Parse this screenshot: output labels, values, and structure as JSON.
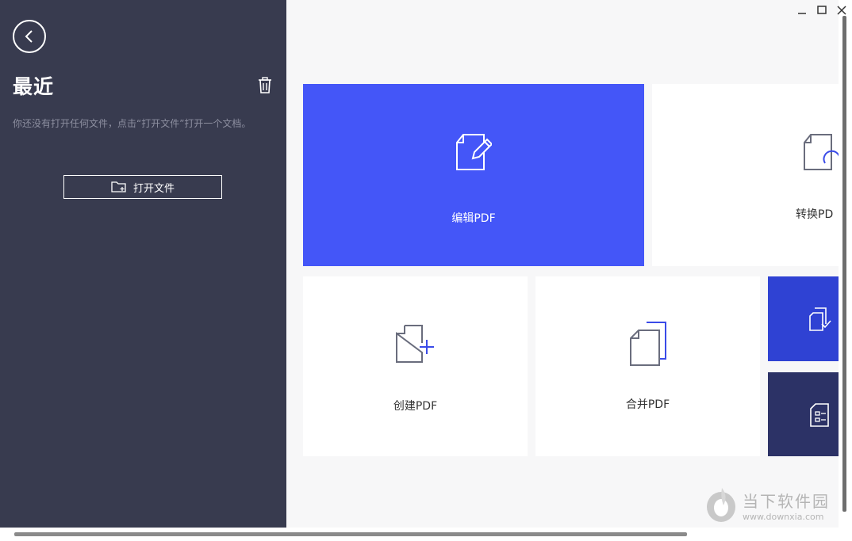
{
  "sidebar": {
    "title": "最近",
    "empty_message": "你还没有打开任何文件，点击“打开文件”打开一个文档。",
    "open_button_label": "打开文件"
  },
  "tiles": {
    "edit_label": "编辑PDF",
    "convert_label": "转换PD",
    "create_label": "创建PDF",
    "combine_label": "合并PDF"
  },
  "colors": {
    "sidebar_bg": "#383b4f",
    "edit_tile": "#4456f8",
    "small_tile_1": "#2f42d3",
    "small_tile_2": "#2c3266",
    "icon_accent": "#3a4be8"
  },
  "icons": {
    "back": "chevron-left-icon",
    "trash": "trash-icon",
    "open_folder": "folder-add-icon",
    "minimize": "minimize-icon",
    "maximize": "maximize-icon",
    "close": "close-icon"
  },
  "watermark": {
    "title": "当下软件园",
    "url": "www.downxia.com"
  }
}
